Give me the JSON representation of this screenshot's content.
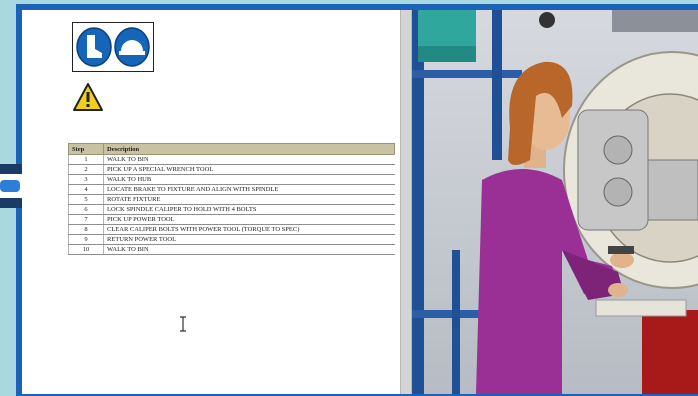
{
  "steps_table": {
    "headers": {
      "step": "Step",
      "description": "Description"
    },
    "rows": [
      {
        "step": "1",
        "description": "WALK TO BIN"
      },
      {
        "step": "2",
        "description": "PICK UP A SPECIAL WRENCH TOOL"
      },
      {
        "step": "3",
        "description": "WALK TO HUB"
      },
      {
        "step": "4",
        "description": "LOCATE BRAKE TO FIXTURE AND ALIGN WITH SPINDLE"
      },
      {
        "step": "5",
        "description": "ROTATE FIXTURE"
      },
      {
        "step": "6",
        "description": "LOCK SPINDLE CALIPER TO HOLD WITH 4 BOLTS"
      },
      {
        "step": "7",
        "description": "PICK UP POWER TOOL"
      },
      {
        "step": "8",
        "description": "CLEAR CALIPER BOLTS WITH POWER TOOL (TORQUE TO SPEC)"
      },
      {
        "step": "9",
        "description": "RETURN POWER TOOL"
      },
      {
        "step": "10",
        "description": "WALK TO BIN"
      }
    ]
  },
  "icons": {
    "ppe_boots": "safety-boots-icon",
    "ppe_helmet": "hard-hat-icon",
    "warning": "warning-triangle-icon",
    "side_tab": "side-panel-tab-icon",
    "cursor": "text-cursor-icon"
  },
  "colors": {
    "frame": "#1c62b8",
    "ppe_blue": "#1565b8",
    "warning_yellow": "#f2cf1f",
    "table_header": "#c9c2a0",
    "worker_shirt": "#9a2f96",
    "background": "#a9d8de"
  }
}
